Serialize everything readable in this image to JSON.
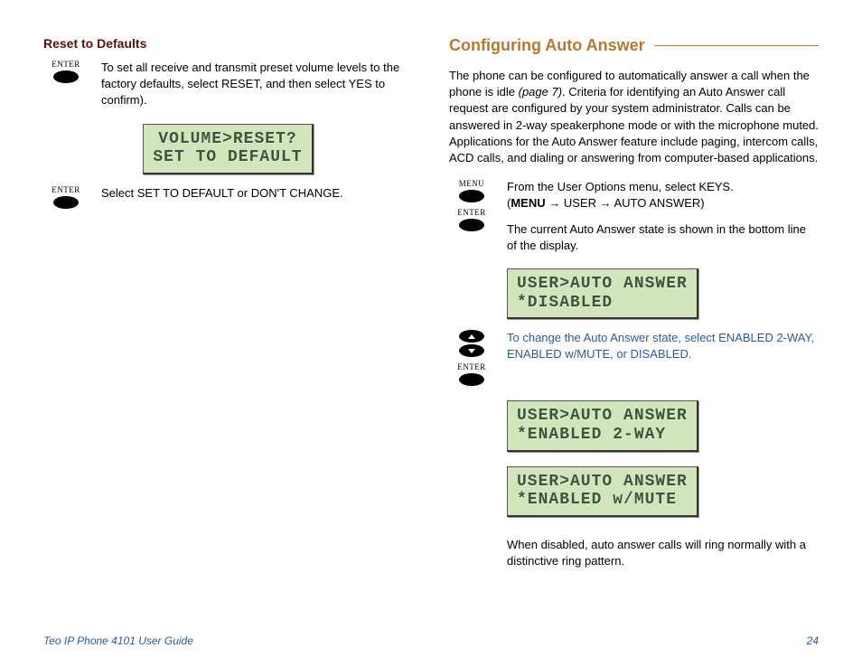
{
  "left": {
    "heading": "Reset to Defaults",
    "step1_text": "To set all receive and transmit preset volume levels to the factory defaults, select RESET, and then select YES to confirm).",
    "lcd1_line1": "VOLUME>RESET?",
    "lcd1_line2": "SET TO DEFAULT",
    "step2_text": "Select SET TO DEFAULT or DON'T CHANGE."
  },
  "right": {
    "heading": "Configuring Auto Answer",
    "intro_a": "The phone can be configured to automatically answer a call when the phone is idle ",
    "intro_ref": "(page 7)",
    "intro_b": ". Criteria for identifying an Auto Answer call request are configured by your system administrator. Calls can be answered in 2-way speakerphone mode or with the microphone muted. Applications for the Auto Answer feature include paging, intercom calls, ACD calls, and dialing or answering from computer-based applications.",
    "step1_a": "From the User Options menu, select KEYS.",
    "step1_b_pre": "(",
    "step1_b_menu": "MENU",
    "step1_b_post": " → USER → AUTO ANSWER)",
    "step1_c": "The current Auto Answer state is shown in the bottom line of the display.",
    "lcd1_line1": "USER>AUTO ANSWER",
    "lcd1_line2": "*DISABLED",
    "step2_text": "To change the Auto Answer state, select ENABLED 2-WAY, ENABLED w/MUTE, or DISABLED.",
    "lcd2_line1": "USER>AUTO ANSWER",
    "lcd2_line2": "*ENABLED 2-WAY",
    "lcd3_line1": "USER>AUTO ANSWER",
    "lcd3_line2": "*ENABLED w/MUTE",
    "closing": "When disabled, auto answer calls will ring normally with a distinctive ring pattern."
  },
  "labels": {
    "enter": "ENTER",
    "menu": "MENU"
  },
  "footer": {
    "left": "Teo IP Phone 4101 User Guide",
    "right": "24"
  }
}
